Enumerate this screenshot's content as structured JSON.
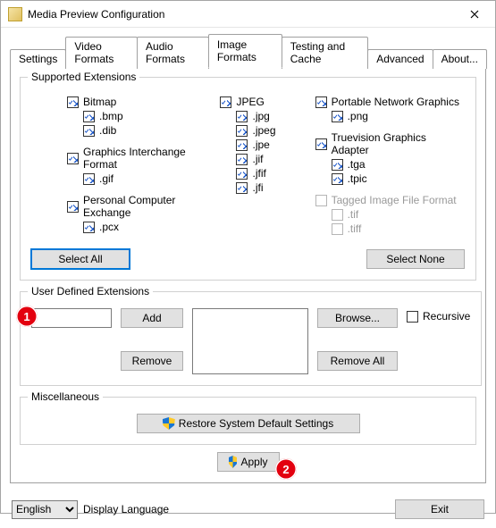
{
  "window": {
    "title": "Media Preview Configuration"
  },
  "tabs": {
    "settings": "Settings",
    "video": "Video Formats",
    "audio": "Audio Formats",
    "image": "Image Formats",
    "testing": "Testing and Cache",
    "advanced": "Advanced",
    "about": "About..."
  },
  "groups": {
    "supported": "Supported Extensions",
    "user_defined": "User Defined Extensions",
    "misc": "Miscellaneous"
  },
  "ext": {
    "bitmap": {
      "label": "Bitmap",
      "items": {
        "bmp": ".bmp",
        "dib": ".dib"
      }
    },
    "gif": {
      "label": "Graphics Interchange Format",
      "items": {
        "gif": ".gif"
      }
    },
    "pcx": {
      "label": "Personal Computer Exchange",
      "items": {
        "pcx": ".pcx"
      }
    },
    "jpeg": {
      "label": "JPEG",
      "items": {
        "jpg": ".jpg",
        "jpeg": ".jpeg",
        "jpe": ".jpe",
        "jif": ".jif",
        "jfif": ".jfif",
        "jfi": ".jfi"
      }
    },
    "png": {
      "label": "Portable Network Graphics",
      "items": {
        "png": ".png"
      }
    },
    "tga": {
      "label": "Truevision Graphics Adapter",
      "items": {
        "tga": ".tga",
        "tpic": ".tpic"
      }
    },
    "tif": {
      "label": "Tagged Image File Format",
      "items": {
        "tif": ".tif",
        "tiff": ".tiff"
      }
    }
  },
  "buttons": {
    "select_all": "Select All",
    "select_none": "Select None",
    "add": "Add",
    "remove": "Remove",
    "browse": "Browse...",
    "remove_all": "Remove All",
    "restore": "Restore System Default Settings",
    "apply": "Apply",
    "exit": "Exit"
  },
  "checkboxes": {
    "recursive": "Recursive"
  },
  "footer": {
    "language_value": "English",
    "language_label": "Display Language"
  },
  "annotations": {
    "a1": "1",
    "a2": "2"
  }
}
